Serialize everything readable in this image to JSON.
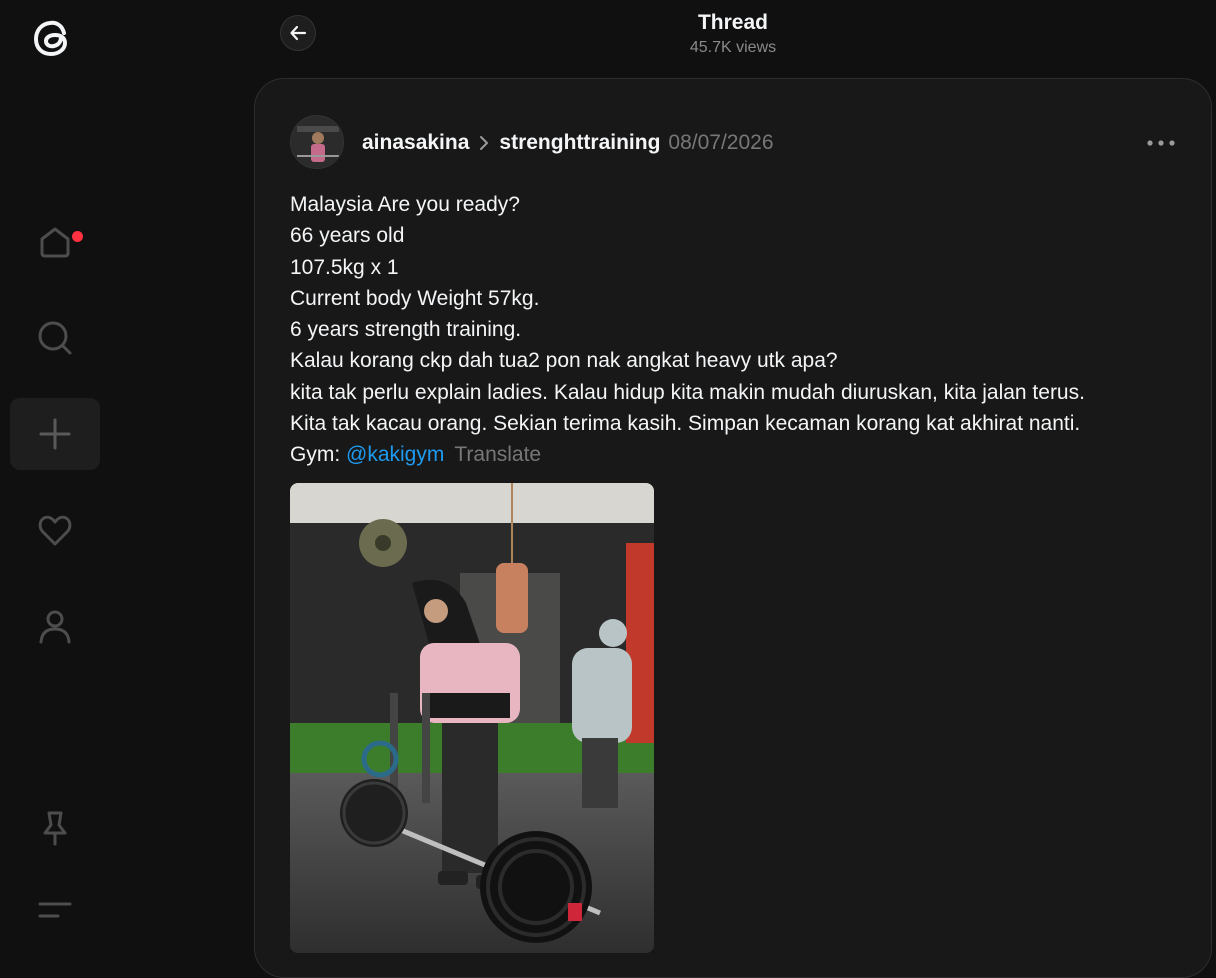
{
  "header": {
    "title": "Thread",
    "views": "45.7K views"
  },
  "sidebar": {
    "items": [
      {
        "name": "home"
      },
      {
        "name": "search"
      },
      {
        "name": "create"
      },
      {
        "name": "activity"
      },
      {
        "name": "profile"
      },
      {
        "name": "pinned"
      },
      {
        "name": "menu"
      }
    ],
    "notification_dot_color": "#ff3040"
  },
  "post": {
    "username": "ainasakina",
    "topic": "strenghttraining",
    "date": "08/07/2026",
    "lines": [
      "Malaysia Are you ready?",
      "66 years old",
      "107.5kg x 1",
      "Current body Weight 57kg.",
      "6 years strength training.",
      "Kalau korang ckp dah tua2 pon nak angkat heavy utk apa?",
      "kita tak perlu explain ladies. Kalau hidup kita makin mudah diuruskan, kita jalan terus.",
      "Kita tak kacau orang. Sekian terima kasih. Simpan kecaman korang kat akhirat nanti."
    ],
    "gym_prefix": "Gym: ",
    "mention": "@kakigym",
    "translate_label": "Translate"
  },
  "colors": {
    "background": "#101010",
    "card": "#181818",
    "mention": "#1d9bf0",
    "secondary_text": "#777777"
  }
}
